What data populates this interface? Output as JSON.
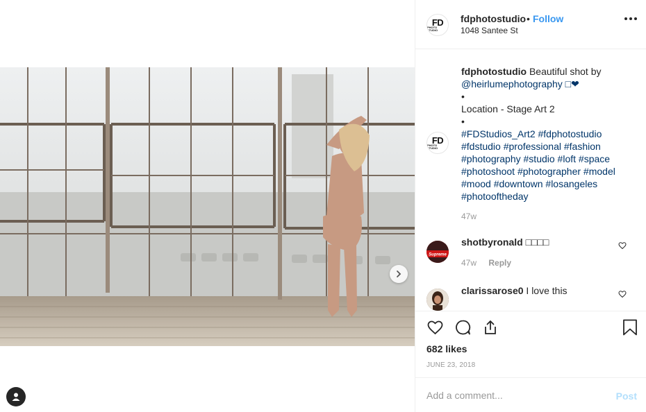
{
  "post": {
    "username": "fdphotostudio",
    "follow_label": "Follow",
    "separator": "•",
    "location": "1048 Santee St",
    "avatar_text_main": "FD",
    "avatar_text_sub": "PHOTO STUDIO"
  },
  "caption": {
    "username": "fdphotostudio",
    "line1": "Beautiful shot by",
    "mention": "@heirlumephotography □❤",
    "bullet": "•",
    "location_line": "Location - Stage Art 2",
    "hashtags": "#FDStudios_Art2 #fdphotostudio #fdstudio #professional #fashion #photography #studio #loft #space #photoshoot #photographer #model #mood #downtown #losangeles #photooftheday",
    "time": "47w"
  },
  "comments": [
    {
      "username": "shotbyronald",
      "text": "□□□□",
      "time": "47w",
      "reply_label": "Reply",
      "avatar_text": "Supreme"
    },
    {
      "username": "clarissarose0",
      "text": "I love this"
    }
  ],
  "actions": {
    "likes": "682 likes",
    "date": "JUNE 23, 2018"
  },
  "composer": {
    "placeholder": "Add a comment...",
    "post_label": "Post"
  },
  "colors": {
    "link": "#3897f0",
    "hashtag": "#003569",
    "muted": "#999999",
    "post_disabled": "#b2dffc"
  }
}
